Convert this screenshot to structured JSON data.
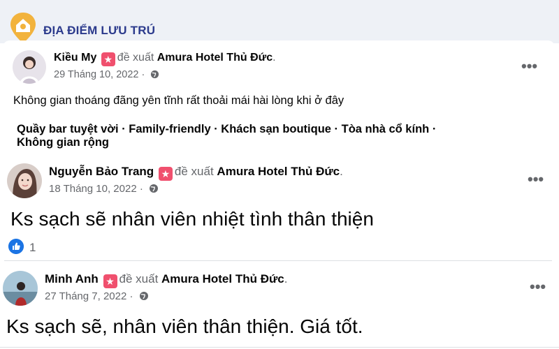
{
  "header": {
    "title": "ĐỊA ĐIỂM LƯU TRÚ"
  },
  "posts": [
    {
      "author": "Kiều My",
      "verb": "đề xuất",
      "place": "Amura Hotel Thủ Đức",
      "date": "29 Tháng 10, 2022 ·",
      "text": "Không gian thoáng đãng yên tĩnh rất thoải mái hài lòng khi ở đây",
      "tags": "Quầy bar tuyệt vời · Family-friendly · Khách sạn boutique · Tòa nhà cổ kính · Không gian rộng"
    },
    {
      "author": "Nguyễn Bảo Trang",
      "verb": "đề xuất",
      "place": "Amura Hotel Thủ Đức",
      "date": "18 Tháng 10, 2022 ·",
      "text": "Ks sạch sẽ nhân viên nhiệt tình thân thiện",
      "reaction_count": "1"
    },
    {
      "author": "Minh Anh",
      "verb": "đề xuất",
      "place": "Amura Hotel Thủ Đức",
      "date": "27 Tháng 7, 2022 ·",
      "text": "Ks sạch sẽ, nhân viên thân thiện. Giá tốt."
    }
  ],
  "more_label": "•••",
  "period": ".",
  "icons": {
    "logo": "location-pin-house-icon",
    "badge": "recommend-star-icon",
    "privacy": "globe-icon",
    "reaction": "like-icon"
  },
  "colors": {
    "accent": "#1b74e4",
    "badge": "#f0506e",
    "header_text": "#2b3a8c",
    "logo": "#f2b33d"
  }
}
